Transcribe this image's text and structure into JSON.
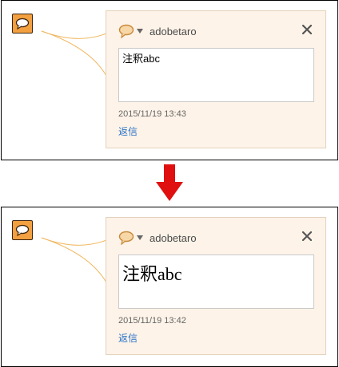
{
  "before": {
    "author": "adobetaro",
    "comment_text": "注釈abc",
    "timestamp": "2015/11/19  13:43",
    "reply_label": "返信",
    "close_glyph": "✕"
  },
  "after": {
    "author": "adobetaro",
    "comment_text": "注釈abc",
    "timestamp": "2015/11/19  13:42",
    "reply_label": "返信",
    "close_glyph": "✕"
  },
  "colors": {
    "note_icon_fill": "#f2a040",
    "comment_bg": "#fdf3e8",
    "connector_line": "#f0b860",
    "arrow": "#e01010",
    "reply_link": "#2a72c8"
  },
  "icons": {
    "note": "speech-bubble-note-icon",
    "header_bubble": "speech-bubble-icon",
    "dropdown": "caret-down-icon",
    "close": "close-icon",
    "transition": "arrow-down-icon"
  }
}
